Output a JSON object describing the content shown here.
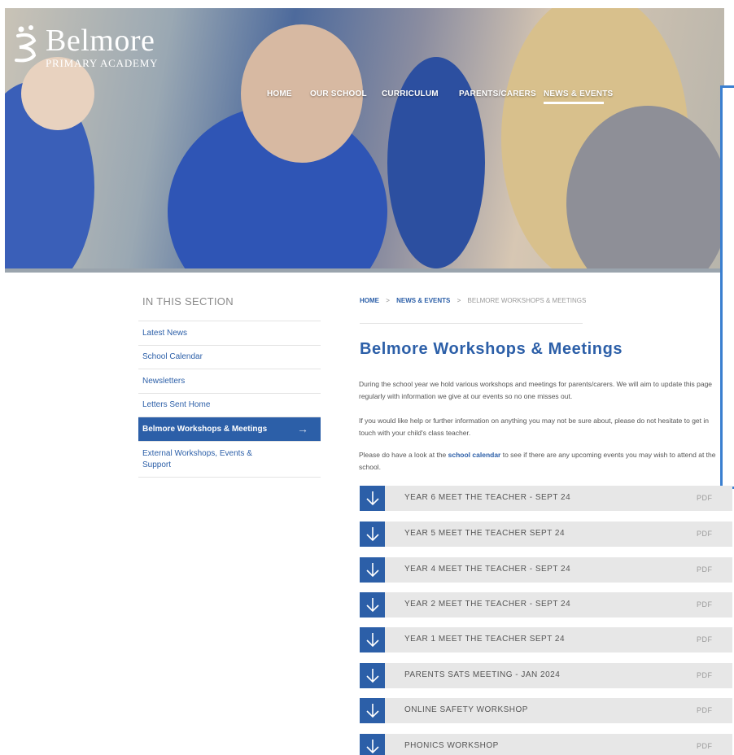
{
  "logo": {
    "name": "Belmore",
    "subtitle": "PRIMARY ACADEMY"
  },
  "nav": [
    {
      "label": "HOME"
    },
    {
      "label": "OUR SCHOOL"
    },
    {
      "label": "CURRICULUM"
    },
    {
      "label": "PARENTS/CARERS"
    },
    {
      "label": "NEWS & EVENTS",
      "active": true
    }
  ],
  "sidebar": {
    "title": "IN THIS SECTION",
    "items": [
      {
        "label": "Latest News"
      },
      {
        "label": "School Calendar"
      },
      {
        "label": "Newsletters"
      },
      {
        "label": "Letters Sent Home"
      },
      {
        "label": "Belmore Workshops & Meetings",
        "active": true,
        "icon": "arrow-right-icon"
      },
      {
        "label": "External Workshops, Events & Support"
      }
    ]
  },
  "breadcrumb": {
    "home": "HOME",
    "section": "NEWS & EVENTS",
    "current": "BELMORE WORKSHOPS & MEETINGS",
    "separator": ">"
  },
  "main": {
    "title": "Belmore Workshops & Meetings",
    "para1": "During the school year we hold various workshops and meetings for parents/carers. We will aim to update this page regularly with information we give at our events so no one misses out.",
    "para2": "If you would like help or further information on anything you may not be sure about, please do not hesitate to get in touch with your child's class teacher.",
    "para3_before": "Please do have a look at the ",
    "para3_link": "school calendar",
    "para3_after": " to see if there are any upcoming events you may wish to attend at the school."
  },
  "downloads": [
    {
      "label": "YEAR 6 MEET THE TEACHER - SEPT 24",
      "type": "PDF"
    },
    {
      "label": "YEAR 5 MEET THE TEACHER SEPT 24",
      "type": "PDF"
    },
    {
      "label": "YEAR 4 MEET THE TEACHER - SEPT 24",
      "type": "PDF"
    },
    {
      "label": "YEAR 2 MEET THE TEACHER - SEPT 24",
      "type": "PDF"
    },
    {
      "label": "YEAR 1 MEET THE TEACHER SEPT 24",
      "type": "PDF"
    },
    {
      "label": "PARENTS SATS MEETING - JAN 2024",
      "type": "PDF"
    },
    {
      "label": "ONLINE SAFETY WORKSHOP",
      "type": "PDF"
    },
    {
      "label": "PHONICS WORKSHOP",
      "type": "PDF"
    }
  ],
  "colors": {
    "brand": "#2c5fa8",
    "row_bg": "#e7e7e7",
    "overlay_border": "#3a7fd0"
  }
}
